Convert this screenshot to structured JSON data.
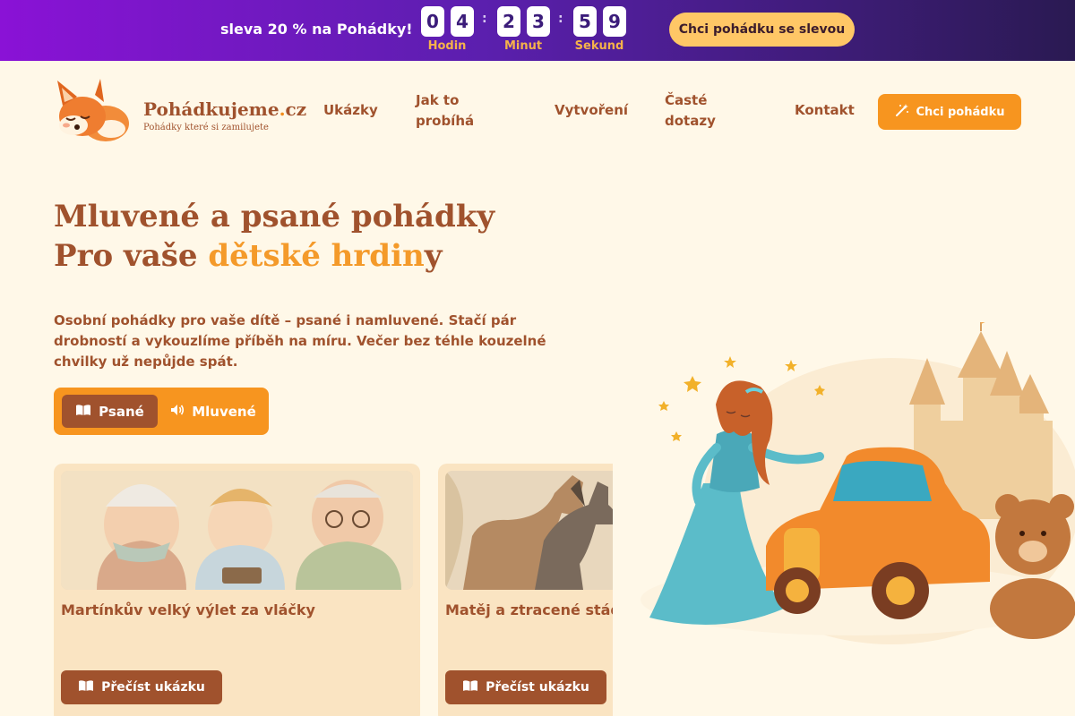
{
  "promo": {
    "text": "sleva 20 % na Pohádky!",
    "countdown": {
      "hours": [
        "0",
        "4"
      ],
      "minutes": [
        "2",
        "3"
      ],
      "seconds": [
        "5",
        "9"
      ],
      "hours_label": "Hodin",
      "minutes_label": "Minut",
      "seconds_label": "Sekund",
      "separator": ":"
    },
    "button_label": "Chci pohádku se slevou"
  },
  "header": {
    "brand_name": "Pohádkujeme",
    "brand_dot": ".",
    "brand_tld": "cz",
    "tagline": "Pohádky které si zamilujete",
    "nav": [
      {
        "label": "Ukázky"
      },
      {
        "label": "Jak to probíhá"
      },
      {
        "label": "Vytvoření"
      },
      {
        "label": "Časté dotazy"
      },
      {
        "label": "Kontakt"
      }
    ],
    "cta_label": "Chci pohádku",
    "cta_icon": "magic-wand-icon"
  },
  "hero": {
    "title_line1": "Mluvené a psané pohádky",
    "title_line2_pre": "Pro vaše ",
    "title_line2_highlight": "dětské hrdin",
    "title_line2_post": "y",
    "text": "Osobní pohádky pro vaše dítě – psané i namluvené. Stačí pár drobností a vykouzlíme příběh na míru. Večer bez téhle kouzelné chvilky už nepůjde spát.",
    "toggle": [
      {
        "label": "Psané",
        "icon": "book-icon",
        "active": true
      },
      {
        "label": "Mluvené",
        "icon": "speaker-icon",
        "active": false
      }
    ]
  },
  "cards": [
    {
      "title": "Martínkův velký výlet za vláčky",
      "button_label": "Přečíst ukázku",
      "icon": "book-icon"
    },
    {
      "title": "Matěj a ztracené stádo",
      "button_label": "Přečíst ukázku",
      "icon": "book-icon"
    }
  ],
  "colors": {
    "promo_start": "#8a12d6",
    "promo_end": "#2a1a52",
    "accent_orange": "#f7951f",
    "brown": "#a0522d",
    "background": "#fff8e8",
    "card_bg": "#fae4c2"
  }
}
